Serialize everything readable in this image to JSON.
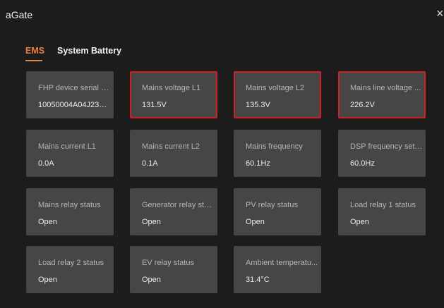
{
  "window": {
    "title": "aGate",
    "close_icon": "×"
  },
  "tabs": [
    {
      "label": "EMS",
      "active": true
    },
    {
      "label": "System Battery",
      "active": false
    }
  ],
  "cards": [
    {
      "label": "FHP device serial n...",
      "value": "10050004A04J2307...",
      "highlighted": false
    },
    {
      "label": "Mains voltage L1",
      "value": "131.5V",
      "highlighted": true
    },
    {
      "label": "Mains voltage L2",
      "value": "135.3V",
      "highlighted": true
    },
    {
      "label": "Mains line voltage ...",
      "value": "226.2V",
      "highlighted": true
    },
    {
      "label": "Mains current L1",
      "value": "0.0A",
      "highlighted": false
    },
    {
      "label": "Mains current L2",
      "value": "0.1A",
      "highlighted": false
    },
    {
      "label": "Mains frequency",
      "value": "60.1Hz",
      "highlighted": false
    },
    {
      "label": "DSP frequency setti...",
      "value": "60.0Hz",
      "highlighted": false
    },
    {
      "label": "Mains relay status",
      "value": "Open",
      "highlighted": false
    },
    {
      "label": "Generator relay stat...",
      "value": "Open",
      "highlighted": false
    },
    {
      "label": "PV relay status",
      "value": "Open",
      "highlighted": false
    },
    {
      "label": "Load relay 1 status",
      "value": "Open",
      "highlighted": false
    },
    {
      "label": "Load relay 2 status",
      "value": "Open",
      "highlighted": false
    },
    {
      "label": "EV relay status",
      "value": "Open",
      "highlighted": false
    },
    {
      "label": "Ambient temperatu...",
      "value": "31.4°C",
      "highlighted": false
    }
  ],
  "colors": {
    "background": "#1c1c1c",
    "card": "#464646",
    "accent": "#e8843a",
    "highlight_border": "#d31e25"
  }
}
